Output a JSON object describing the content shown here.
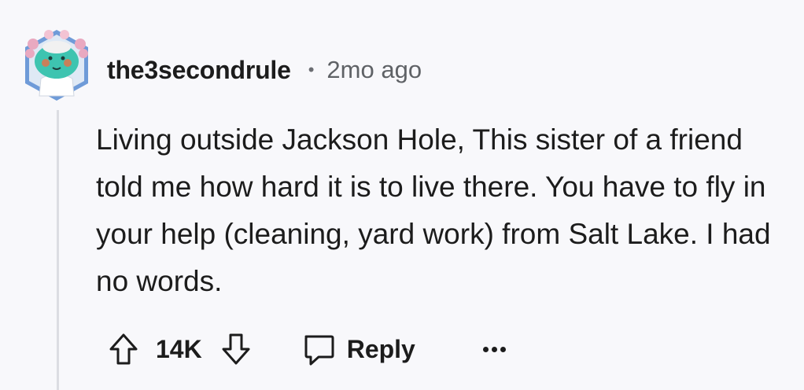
{
  "comment": {
    "author": "the3secondrule",
    "separator": "•",
    "timestamp": "2mo ago",
    "body": "Living outside Jackson Hole, This sister of a friend told me how hard it is to live there. You have to fly in your help (cleaning, yard work) from Salt Lake. I had no words.",
    "score": "14K",
    "reply_label": "Reply",
    "avatar_icon": "axolotl-avatar-icon",
    "upvote_icon": "arrow-up-icon",
    "downvote_icon": "arrow-down-icon",
    "reply_icon": "speech-bubble-icon",
    "more_icon": "ellipsis-icon"
  },
  "colors": {
    "background": "#f8f8fb",
    "text": "#1c1c1c",
    "muted": "#5f6266",
    "thread_line": "#dcdde2"
  }
}
